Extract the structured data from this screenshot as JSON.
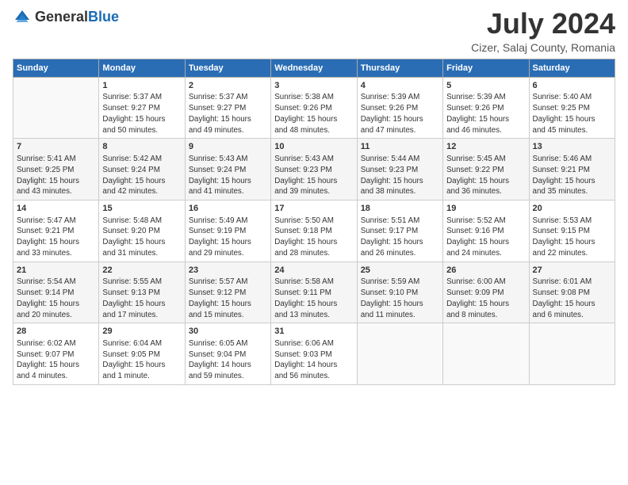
{
  "header": {
    "logo_general": "General",
    "logo_blue": "Blue",
    "month_title": "July 2024",
    "location": "Cizer, Salaj County, Romania"
  },
  "weekdays": [
    "Sunday",
    "Monday",
    "Tuesday",
    "Wednesday",
    "Thursday",
    "Friday",
    "Saturday"
  ],
  "weeks": [
    [
      {
        "day": "",
        "info": ""
      },
      {
        "day": "1",
        "info": "Sunrise: 5:37 AM\nSunset: 9:27 PM\nDaylight: 15 hours\nand 50 minutes."
      },
      {
        "day": "2",
        "info": "Sunrise: 5:37 AM\nSunset: 9:27 PM\nDaylight: 15 hours\nand 49 minutes."
      },
      {
        "day": "3",
        "info": "Sunrise: 5:38 AM\nSunset: 9:26 PM\nDaylight: 15 hours\nand 48 minutes."
      },
      {
        "day": "4",
        "info": "Sunrise: 5:39 AM\nSunset: 9:26 PM\nDaylight: 15 hours\nand 47 minutes."
      },
      {
        "day": "5",
        "info": "Sunrise: 5:39 AM\nSunset: 9:26 PM\nDaylight: 15 hours\nand 46 minutes."
      },
      {
        "day": "6",
        "info": "Sunrise: 5:40 AM\nSunset: 9:25 PM\nDaylight: 15 hours\nand 45 minutes."
      }
    ],
    [
      {
        "day": "7",
        "info": "Sunrise: 5:41 AM\nSunset: 9:25 PM\nDaylight: 15 hours\nand 43 minutes."
      },
      {
        "day": "8",
        "info": "Sunrise: 5:42 AM\nSunset: 9:24 PM\nDaylight: 15 hours\nand 42 minutes."
      },
      {
        "day": "9",
        "info": "Sunrise: 5:43 AM\nSunset: 9:24 PM\nDaylight: 15 hours\nand 41 minutes."
      },
      {
        "day": "10",
        "info": "Sunrise: 5:43 AM\nSunset: 9:23 PM\nDaylight: 15 hours\nand 39 minutes."
      },
      {
        "day": "11",
        "info": "Sunrise: 5:44 AM\nSunset: 9:23 PM\nDaylight: 15 hours\nand 38 minutes."
      },
      {
        "day": "12",
        "info": "Sunrise: 5:45 AM\nSunset: 9:22 PM\nDaylight: 15 hours\nand 36 minutes."
      },
      {
        "day": "13",
        "info": "Sunrise: 5:46 AM\nSunset: 9:21 PM\nDaylight: 15 hours\nand 35 minutes."
      }
    ],
    [
      {
        "day": "14",
        "info": "Sunrise: 5:47 AM\nSunset: 9:21 PM\nDaylight: 15 hours\nand 33 minutes."
      },
      {
        "day": "15",
        "info": "Sunrise: 5:48 AM\nSunset: 9:20 PM\nDaylight: 15 hours\nand 31 minutes."
      },
      {
        "day": "16",
        "info": "Sunrise: 5:49 AM\nSunset: 9:19 PM\nDaylight: 15 hours\nand 29 minutes."
      },
      {
        "day": "17",
        "info": "Sunrise: 5:50 AM\nSunset: 9:18 PM\nDaylight: 15 hours\nand 28 minutes."
      },
      {
        "day": "18",
        "info": "Sunrise: 5:51 AM\nSunset: 9:17 PM\nDaylight: 15 hours\nand 26 minutes."
      },
      {
        "day": "19",
        "info": "Sunrise: 5:52 AM\nSunset: 9:16 PM\nDaylight: 15 hours\nand 24 minutes."
      },
      {
        "day": "20",
        "info": "Sunrise: 5:53 AM\nSunset: 9:15 PM\nDaylight: 15 hours\nand 22 minutes."
      }
    ],
    [
      {
        "day": "21",
        "info": "Sunrise: 5:54 AM\nSunset: 9:14 PM\nDaylight: 15 hours\nand 20 minutes."
      },
      {
        "day": "22",
        "info": "Sunrise: 5:55 AM\nSunset: 9:13 PM\nDaylight: 15 hours\nand 17 minutes."
      },
      {
        "day": "23",
        "info": "Sunrise: 5:57 AM\nSunset: 9:12 PM\nDaylight: 15 hours\nand 15 minutes."
      },
      {
        "day": "24",
        "info": "Sunrise: 5:58 AM\nSunset: 9:11 PM\nDaylight: 15 hours\nand 13 minutes."
      },
      {
        "day": "25",
        "info": "Sunrise: 5:59 AM\nSunset: 9:10 PM\nDaylight: 15 hours\nand 11 minutes."
      },
      {
        "day": "26",
        "info": "Sunrise: 6:00 AM\nSunset: 9:09 PM\nDaylight: 15 hours\nand 8 minutes."
      },
      {
        "day": "27",
        "info": "Sunrise: 6:01 AM\nSunset: 9:08 PM\nDaylight: 15 hours\nand 6 minutes."
      }
    ],
    [
      {
        "day": "28",
        "info": "Sunrise: 6:02 AM\nSunset: 9:07 PM\nDaylight: 15 hours\nand 4 minutes."
      },
      {
        "day": "29",
        "info": "Sunrise: 6:04 AM\nSunset: 9:05 PM\nDaylight: 15 hours\nand 1 minute."
      },
      {
        "day": "30",
        "info": "Sunrise: 6:05 AM\nSunset: 9:04 PM\nDaylight: 14 hours\nand 59 minutes."
      },
      {
        "day": "31",
        "info": "Sunrise: 6:06 AM\nSunset: 9:03 PM\nDaylight: 14 hours\nand 56 minutes."
      },
      {
        "day": "",
        "info": ""
      },
      {
        "day": "",
        "info": ""
      },
      {
        "day": "",
        "info": ""
      }
    ]
  ]
}
